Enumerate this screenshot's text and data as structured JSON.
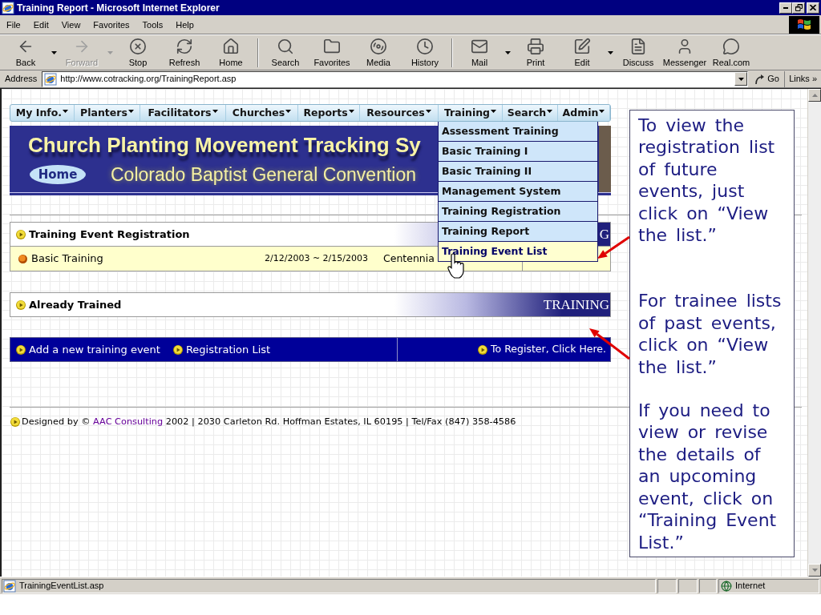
{
  "window": {
    "title": "Training Report - Microsoft Internet Explorer"
  },
  "menu_bar": {
    "items": [
      "File",
      "Edit",
      "View",
      "Favorites",
      "Tools",
      "Help"
    ]
  },
  "toolbar": {
    "groups": [
      [
        {
          "label": "Back",
          "disabled": false,
          "has_menu": true
        },
        {
          "label": "Forward",
          "disabled": true,
          "has_menu": true
        },
        {
          "label": "Stop",
          "disabled": false,
          "has_menu": false
        },
        {
          "label": "Refresh",
          "disabled": false,
          "has_menu": false
        },
        {
          "label": "Home",
          "disabled": false,
          "has_menu": false
        }
      ],
      [
        {
          "label": "Search",
          "disabled": false,
          "has_menu": false
        },
        {
          "label": "Favorites",
          "disabled": false,
          "has_menu": false
        },
        {
          "label": "Media",
          "disabled": false,
          "has_menu": false
        },
        {
          "label": "History",
          "disabled": false,
          "has_menu": false
        }
      ],
      [
        {
          "label": "Mail",
          "disabled": false,
          "has_menu": true
        },
        {
          "label": "Print",
          "disabled": false,
          "has_menu": false
        },
        {
          "label": "Edit",
          "disabled": false,
          "has_menu": true
        },
        {
          "label": "Discuss",
          "disabled": false,
          "has_menu": false
        },
        {
          "label": "Messenger",
          "disabled": false,
          "has_menu": false
        },
        {
          "label": "Real.com",
          "disabled": false,
          "has_menu": false
        }
      ]
    ]
  },
  "address_bar": {
    "label": "Address",
    "url": "http://www.cotracking.org/TrainingReport.asp",
    "go_button": "Go",
    "links_button": "Links",
    "links_chevron": "»"
  },
  "site_nav": {
    "items": [
      {
        "label": "My Info."
      },
      {
        "label": "Planters"
      },
      {
        "label": "Facilitators"
      },
      {
        "label": "Churches"
      },
      {
        "label": "Reports"
      },
      {
        "label": "Resources"
      },
      {
        "label": "Training",
        "menu": [
          {
            "label": "Assessment Training",
            "selected": false
          },
          {
            "label": "Basic Training I",
            "selected": false
          },
          {
            "label": "Basic Training II",
            "selected": false
          },
          {
            "label": "Management System",
            "selected": false
          },
          {
            "label": "Training Registration",
            "selected": false
          },
          {
            "label": "Training Report",
            "selected": false
          },
          {
            "label": "Training Event List",
            "selected": true
          }
        ]
      },
      {
        "label": "Search"
      },
      {
        "label": "Admin"
      }
    ]
  },
  "banner": {
    "title": "Church Planting Movement Tracking Sy",
    "home_button": "Home",
    "subtitle": "Colorado Baptist General Convention"
  },
  "sections": [
    {
      "title": "Training Event Registration",
      "banner_word": "G",
      "rows": [
        {
          "name": "Basic Training",
          "dates": "2/12/2003 ~ 2/15/2003",
          "location": "Centennia"
        }
      ]
    },
    {
      "title": "Already Trained",
      "banner_word": "TRAINING"
    }
  ],
  "action_bar": {
    "left_links": [
      "Add a new training event",
      "Registration List"
    ],
    "right_link": "To Register, Click Here."
  },
  "footer": {
    "prefix": "Designed by ©",
    "link": "AAC Consulting",
    "suffix": "2002 | 2030 Carleton Rd. Hoffman Estates, IL 60195 | Tel/Fax (847) 358-4586"
  },
  "callout": {
    "paragraphs": [
      "To view the registration list of future events, just click on “View the list.”",
      "For trainee lists of past events, click on “View the list.”",
      "If you need to view or revise the details of an upcoming event, click on “Training Event List.”"
    ]
  },
  "status_bar": {
    "text": "TrainingEventList.asp",
    "zone": "Internet"
  }
}
